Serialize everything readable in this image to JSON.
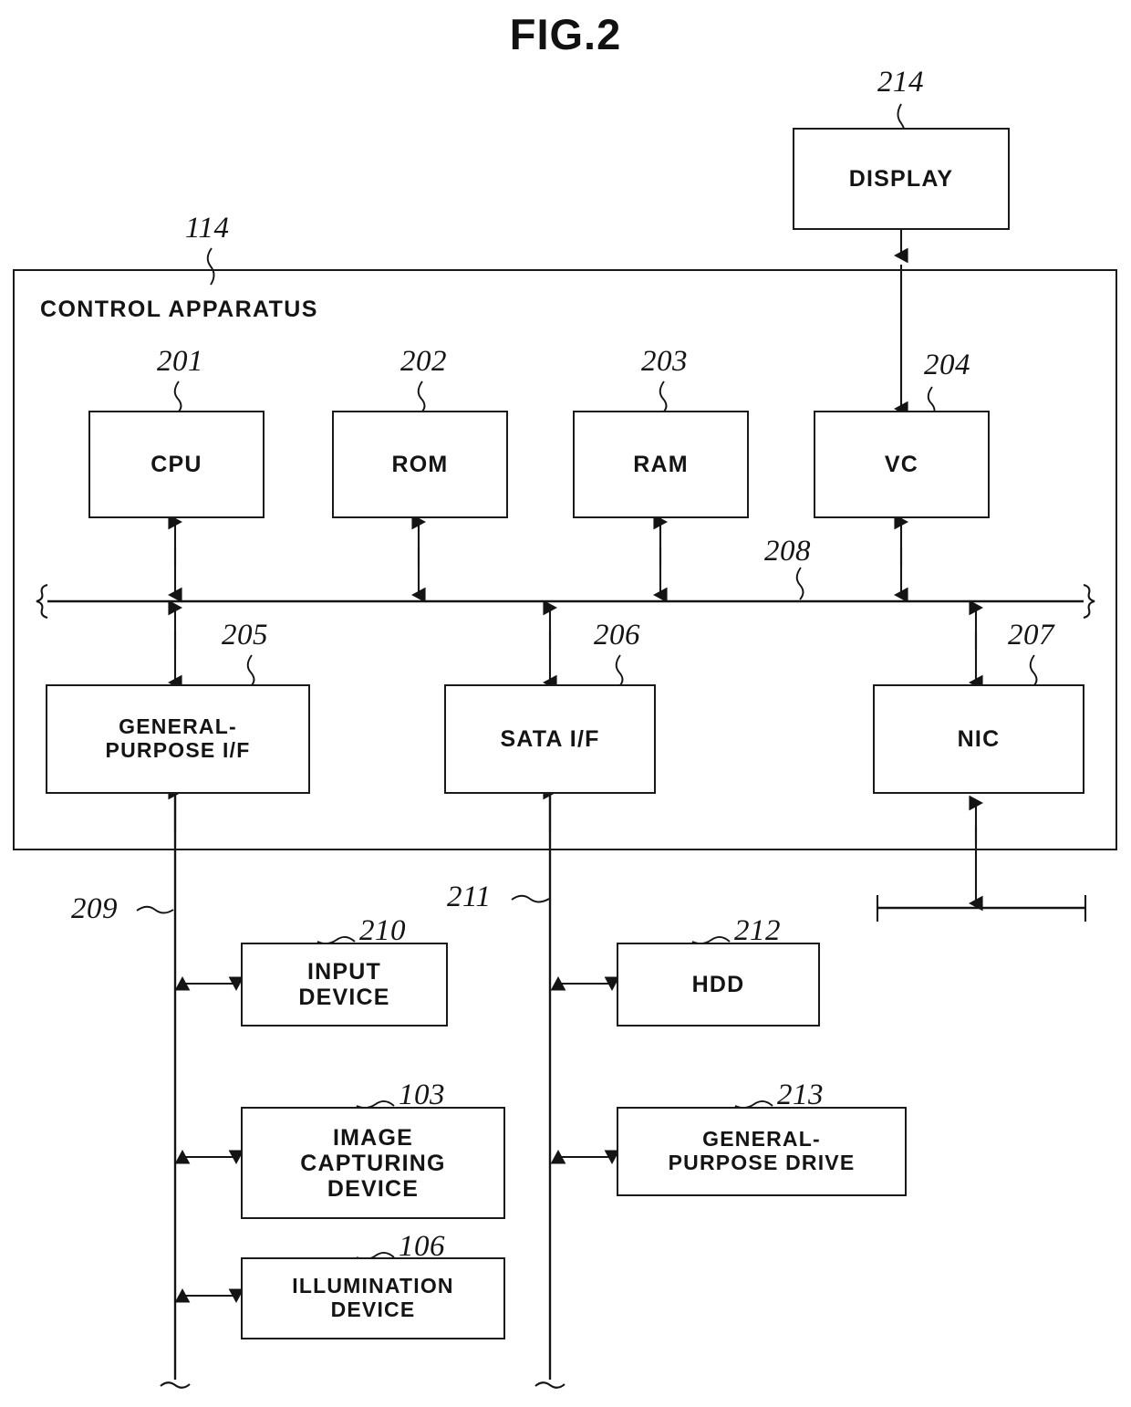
{
  "figure": {
    "title": "FIG.2",
    "container_label": "CONTROL APPARATUS",
    "container_ref": "114"
  },
  "blocks": {
    "display": {
      "label": "DISPLAY",
      "ref": "214"
    },
    "cpu": {
      "label": "CPU",
      "ref": "201"
    },
    "rom": {
      "label": "ROM",
      "ref": "202"
    },
    "ram": {
      "label": "RAM",
      "ref": "203"
    },
    "vc": {
      "label": "VC",
      "ref": "204"
    },
    "general_if": {
      "label": "GENERAL-\nPURPOSE I/F",
      "ref": "205"
    },
    "sata_if": {
      "label": "SATA I/F",
      "ref": "206"
    },
    "nic": {
      "label": "NIC",
      "ref": "207"
    },
    "input_device": {
      "label": "INPUT\nDEVICE",
      "ref": "210"
    },
    "hdd": {
      "label": "HDD",
      "ref": "212"
    },
    "image_capture": {
      "label": "IMAGE\nCAPTURING\nDEVICE",
      "ref": "103"
    },
    "general_drive": {
      "label": "GENERAL-\nPURPOSE DRIVE",
      "ref": "213"
    },
    "illumination": {
      "label": "ILLUMINATION\nDEVICE",
      "ref": "106"
    }
  },
  "buses": {
    "system_bus": {
      "ref": "208"
    },
    "general_bus": {
      "ref": "209"
    },
    "sata_bus": {
      "ref": "211"
    }
  },
  "colors": {
    "ink": "#141414",
    "background": "#ffffff"
  }
}
